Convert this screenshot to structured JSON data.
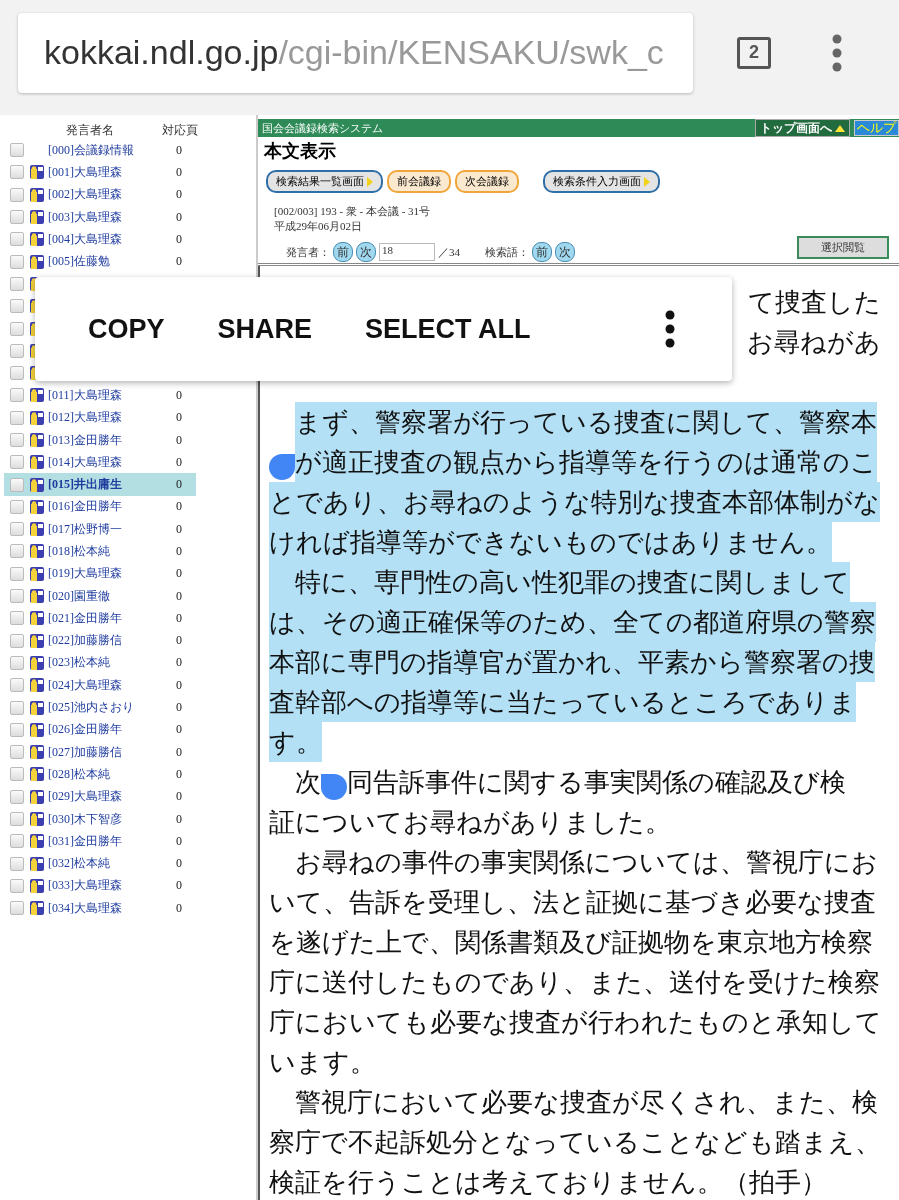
{
  "browser": {
    "url_host": "kokkai.ndl.go.jp",
    "url_path": "/cgi-bin/KENSAKU/swk_c",
    "tab_count": "2"
  },
  "sidebar": {
    "columns": [
      "発言者名",
      "対応頁"
    ],
    "rows": [
      {
        "label": "[000]会議録情報",
        "page": "0",
        "icon": false,
        "checked": false,
        "selected": false
      },
      {
        "label": "[001]大島理森",
        "page": "0",
        "icon": true,
        "checked": false,
        "selected": false
      },
      {
        "label": "[002]大島理森",
        "page": "0",
        "icon": true,
        "checked": false,
        "selected": false
      },
      {
        "label": "[003]大島理森",
        "page": "0",
        "icon": true,
        "checked": false,
        "selected": false
      },
      {
        "label": "[004]大島理森",
        "page": "0",
        "icon": true,
        "checked": false,
        "selected": false
      },
      {
        "label": "[005]佐藤勉",
        "page": "0",
        "icon": true,
        "checked": false,
        "selected": false
      },
      {
        "icon": true,
        "checked": false,
        "selected": false
      },
      {
        "icon": true,
        "checked": false,
        "selected": false
      },
      {
        "icon": true,
        "checked": false,
        "selected": false
      },
      {
        "icon": true,
        "checked": false,
        "selected": false
      },
      {
        "icon": true,
        "checked": false,
        "selected": false
      },
      {
        "label": "[011]大島理森",
        "page": "0",
        "icon": true,
        "checked": false,
        "selected": false
      },
      {
        "label": "[012]大島理森",
        "page": "0",
        "icon": true,
        "checked": false,
        "selected": false
      },
      {
        "label": "[013]金田勝年",
        "page": "0",
        "icon": true,
        "checked": false,
        "selected": false
      },
      {
        "label": "[014]大島理森",
        "page": "0",
        "icon": true,
        "checked": false,
        "selected": false
      },
      {
        "label": "[015]井出庸生",
        "page": "0",
        "icon": true,
        "checked": false,
        "selected": true
      },
      {
        "label": "[016]金田勝年",
        "page": "0",
        "icon": true,
        "checked": false,
        "selected": false
      },
      {
        "label": "[017]松野博一",
        "page": "0",
        "icon": true,
        "checked": false,
        "selected": false
      },
      {
        "label": "[018]松本純",
        "page": "0",
        "icon": true,
        "checked": false,
        "selected": false
      },
      {
        "label": "[019]大島理森",
        "page": "0",
        "icon": true,
        "checked": false,
        "selected": false
      },
      {
        "label": "[020]園重徹",
        "page": "0",
        "icon": true,
        "checked": false,
        "selected": false
      },
      {
        "label": "[021]金田勝年",
        "page": "0",
        "icon": true,
        "checked": false,
        "selected": false
      },
      {
        "label": "[022]加藤勝信",
        "page": "0",
        "icon": true,
        "checked": false,
        "selected": false
      },
      {
        "label": "[023]松本純",
        "page": "0",
        "icon": true,
        "checked": false,
        "selected": false
      },
      {
        "label": "[024]大島理森",
        "page": "0",
        "icon": true,
        "checked": false,
        "selected": false
      },
      {
        "label": "[025]池内さおり",
        "page": "0",
        "icon": true,
        "checked": false,
        "selected": false
      },
      {
        "label": "[026]金田勝年",
        "page": "0",
        "icon": true,
        "checked": false,
        "selected": false
      },
      {
        "label": "[027]加藤勝信",
        "page": "0",
        "icon": true,
        "checked": false,
        "selected": false
      },
      {
        "label": "[028]松本純",
        "page": "0",
        "icon": true,
        "checked": false,
        "selected": false
      },
      {
        "label": "[029]大島理森",
        "page": "0",
        "icon": true,
        "checked": false,
        "selected": false
      },
      {
        "label": "[030]木下智彦",
        "page": "0",
        "icon": true,
        "checked": false,
        "selected": false
      },
      {
        "label": "[031]金田勝年",
        "page": "0",
        "icon": true,
        "checked": false,
        "selected": false
      },
      {
        "label": "[032]松本純",
        "page": "0",
        "icon": true,
        "checked": false,
        "selected": false
      },
      {
        "label": "[033]大島理森",
        "page": "0",
        "icon": true,
        "checked": false,
        "selected": false
      },
      {
        "label": "[034]大島理森",
        "page": "0",
        "icon": true,
        "checked": false,
        "selected": false
      }
    ]
  },
  "header": {
    "system_title": "国会会議録検索システム",
    "top_button": "トップ画面へ",
    "help_button": "ヘルプ",
    "page_title": "本文表示",
    "nav_buttons": [
      {
        "label": "検索結果一覧画面",
        "kind": "blue"
      },
      {
        "label": "前会議録",
        "kind": "orange"
      },
      {
        "label": "次会議録",
        "kind": "orange"
      },
      {
        "label": "検索条件入力画面",
        "kind": "blue"
      }
    ],
    "meeting": "[002/003] 193 - 衆 - 本会議 - 31号",
    "date": "平成29年06月02日",
    "speaker_label": "発言者：",
    "prev": "前",
    "next": "次",
    "speaker_value": "18",
    "speaker_total": "／34",
    "term_label": "検索語：",
    "term_prev": "前",
    "term_next": "次",
    "view_button": "選択閲覧"
  },
  "body": {
    "lines": [
      {
        "kind": "partial",
        "text": "て捜査した",
        "selected": false
      },
      {
        "kind": "partial",
        "text": "お尋ねがあ",
        "selected": false
      },
      {
        "kind": "text",
        "indent": true,
        "text": "まず、警察署が行っている捜査に関して、警察本",
        "selected": true,
        "selection_start": true
      },
      {
        "kind": "text",
        "handle_start": true,
        "text": "が適正捜査の観点から指導等を行うのは通常のこ",
        "selected": true
      },
      {
        "kind": "text",
        "text": "とであり、お尋ねのような特別な捜査本部体制がな",
        "selected": true
      },
      {
        "kind": "text",
        "text": "ければ指導等ができないものではありません。",
        "selected": true
      },
      {
        "kind": "text",
        "indent": true,
        "text": "特に、専門性の高い性犯罪の捜査に関しまして",
        "selected": true
      },
      {
        "kind": "text",
        "text": "は、その適正確保等のため、全ての都道府県の警察",
        "selected": true
      },
      {
        "kind": "text",
        "text": "本部に専門の指導官が置かれ、平素から警察署の捜",
        "selected": true
      },
      {
        "kind": "text",
        "text": "査幹部への指導等に当たっているところでありま",
        "selected": true
      },
      {
        "kind": "text",
        "text": "す。",
        "selected": true
      },
      {
        "kind": "text",
        "indent": true,
        "lead": "次",
        "handle_end": true,
        "text": "同告訴事件に関する事実関係の確認及び検",
        "selected": false
      },
      {
        "kind": "text",
        "text": "証についてお尋ねがありました。",
        "selected": false
      },
      {
        "kind": "text",
        "indent": true,
        "text": "お尋ねの事件の事実関係については、警視庁にお",
        "selected": false
      },
      {
        "kind": "text",
        "text": "いて、告訴を受理し、法と証拠に基づき必要な捜査",
        "selected": false
      },
      {
        "kind": "text",
        "text": "を遂げた上で、関係書類及び証拠物を東京地方検察",
        "selected": false
      },
      {
        "kind": "text",
        "text": "庁に送付したものであり、また、送付を受けた検察",
        "selected": false
      },
      {
        "kind": "text",
        "text": "庁においても必要な捜査が行われたものと承知して",
        "selected": false
      },
      {
        "kind": "text",
        "text": "います。",
        "selected": false
      },
      {
        "kind": "text",
        "indent": true,
        "text": "警視庁において必要な捜査が尽くされ、また、検",
        "selected": false
      },
      {
        "kind": "text",
        "text": "察庁で不起訴処分となっていることなども踏まえ、",
        "selected": false
      },
      {
        "kind": "text",
        "text": "検証を行うことは考えておりません。（拍手）",
        "selected": false
      }
    ]
  },
  "context_menu": {
    "items": [
      "COPY",
      "SHARE",
      "SELECT ALL"
    ]
  }
}
